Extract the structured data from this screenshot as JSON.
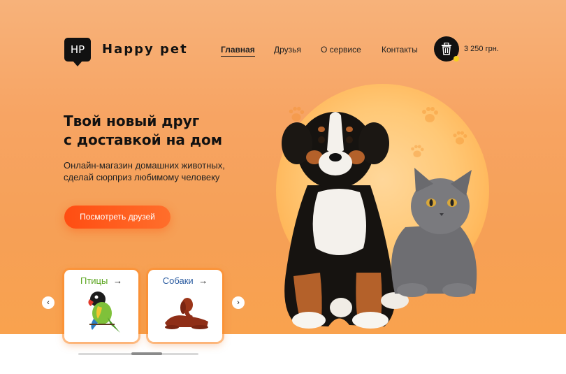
{
  "brand": {
    "logo_text": "HP",
    "name": "Happy pet"
  },
  "nav": {
    "items": [
      {
        "label": "Главная",
        "active": true
      },
      {
        "label": "Друзья",
        "active": false
      },
      {
        "label": "О сервисе",
        "active": false
      },
      {
        "label": "Контакты",
        "active": false
      }
    ]
  },
  "cart": {
    "total": "3 250 грн.",
    "icon": "basket-icon",
    "badge_color": "#f5d020"
  },
  "hero": {
    "title_line1": "Твой новый друг",
    "title_line2": "с доставкой на дом",
    "subtitle": "Онлайн-магазин домашних животных, сделай сюрприз любимому человеку",
    "cta_label": "Посмотреть друзей",
    "images": [
      "puppy-photo",
      "kitten-photo"
    ]
  },
  "categories": {
    "items": [
      {
        "label": "Птицы",
        "arrow": "→",
        "color": "#5aa51e",
        "image": "parrot-photo"
      },
      {
        "label": "Собаки",
        "arrow": "→",
        "color": "#2a5ba0",
        "image": "setter-dog-photo"
      }
    ],
    "prev": "‹",
    "next": "›"
  },
  "colors": {
    "accent": "#ff5a1c",
    "hero_bg": "#f7a463",
    "text": "#111111"
  }
}
